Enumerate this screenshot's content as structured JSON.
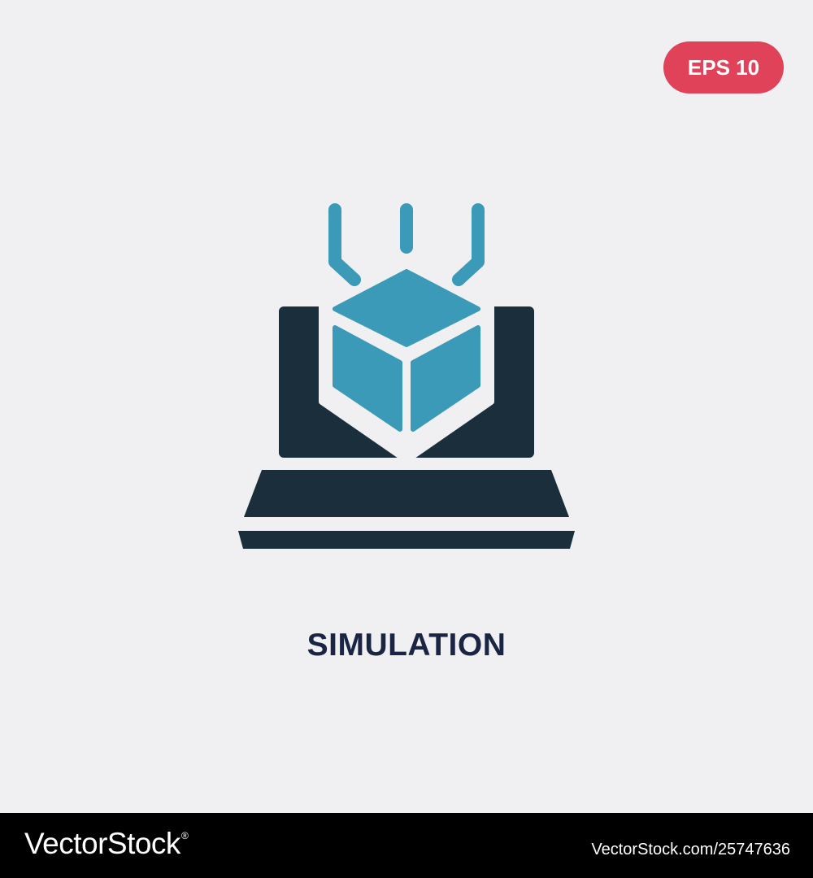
{
  "badge": {
    "label": "EPS 10"
  },
  "icon": {
    "name": "simulation-icon",
    "dark_color": "#1b2e3c",
    "accent_color": "#3a9ab8"
  },
  "title": "SIMULATION",
  "footer": {
    "brand": "VectorStock",
    "brand_mark": "®",
    "url_text": "VectorStock.com/25747636"
  }
}
